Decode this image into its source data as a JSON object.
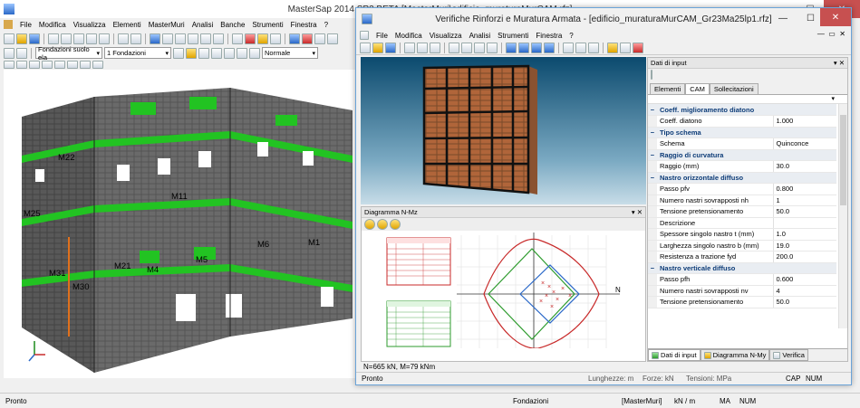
{
  "main": {
    "title": "MasterSap 2014 SP2 BETA [MasterMuri\\edificio_muraturaMurCAM.rfz]",
    "menu": [
      "File",
      "Modifica",
      "Visualizza",
      "Elementi",
      "MasterMuri",
      "Analisi",
      "Banche",
      "Strumenti",
      "Finestra",
      "?"
    ],
    "combo1": "Fondazioni suolo ela",
    "combo2": "1 Fondazioni",
    "combo3": "Normale",
    "wall_labels": [
      "M22",
      "M25",
      "M31",
      "M30",
      "M21",
      "M4",
      "M5",
      "M6",
      "M1",
      "M11"
    ],
    "status": {
      "left": "Pronto",
      "mid": "Fondazioni",
      "units": "kN / m",
      "app": "[MasterMuri]",
      "cap": "MA",
      "num": "NUM"
    }
  },
  "child": {
    "title": "Verifiche Rinforzi e Muratura Armata - [edificio_muraturaMurCAM_Gr23Ma25lp1.rfz]",
    "menu": [
      "File",
      "Modifica",
      "Visualizza",
      "Analisi",
      "Strumenti",
      "Finestra",
      "?"
    ],
    "diagram_title": "Diagramma N-Mz",
    "diagram_readout": "N=665 kN,  M=79 kNm",
    "status": {
      "left": "Pronto",
      "l1": "Lunghezze: m",
      "l2": "Forze: kN",
      "l3": "Tensioni: MPa",
      "cap": "CAP",
      "num": "NUM"
    }
  },
  "panel": {
    "title": "Dati di input",
    "tabs": [
      "Elementi",
      "CAM",
      "Sollecitazioni"
    ],
    "active_tab": "CAM",
    "rows": [
      {
        "type": "cat",
        "label": "Coeff. miglioramento diatono"
      },
      {
        "type": "prop",
        "label": "Coeff. diatono",
        "value": "1.000"
      },
      {
        "type": "cat",
        "label": "Tipo schema"
      },
      {
        "type": "prop",
        "label": "Schema",
        "value": "Quinconce"
      },
      {
        "type": "cat",
        "label": "Raggio di curvatura"
      },
      {
        "type": "prop",
        "label": "Raggio (mm)",
        "value": "30.0"
      },
      {
        "type": "cat",
        "label": "Nastro orizzontale diffuso"
      },
      {
        "type": "prop",
        "label": "Passo pfv",
        "value": "0.800"
      },
      {
        "type": "prop",
        "label": "Numero nastri sovrapposti nh",
        "value": "1"
      },
      {
        "type": "prop",
        "label": "Tensione pretensionamento",
        "value": "50.0"
      },
      {
        "type": "prop",
        "label": "Descrizione",
        "value": ""
      },
      {
        "type": "prop",
        "label": "Spessore singolo nastro t (mm)",
        "value": "1.0"
      },
      {
        "type": "prop",
        "label": "Larghezza singolo nastro b (mm)",
        "value": "19.0"
      },
      {
        "type": "prop",
        "label": "Resistenza a trazione fyd",
        "value": "200.0"
      },
      {
        "type": "cat",
        "label": "Nastro verticale diffuso"
      },
      {
        "type": "prop",
        "label": "Passo pfh",
        "value": "0.600"
      },
      {
        "type": "prop",
        "label": "Numero nastri sovrapposti nv",
        "value": "4"
      },
      {
        "type": "prop",
        "label": "Tensione pretensionamento",
        "value": "50.0"
      }
    ],
    "bottom_tabs": [
      "Dati di input",
      "Diagramma N-My",
      "Verifica"
    ]
  },
  "colors": {
    "wall_gray": "#5c5c5c",
    "ring_green": "#22c322",
    "brick": "#b0653a",
    "accent": "#0078d7"
  }
}
